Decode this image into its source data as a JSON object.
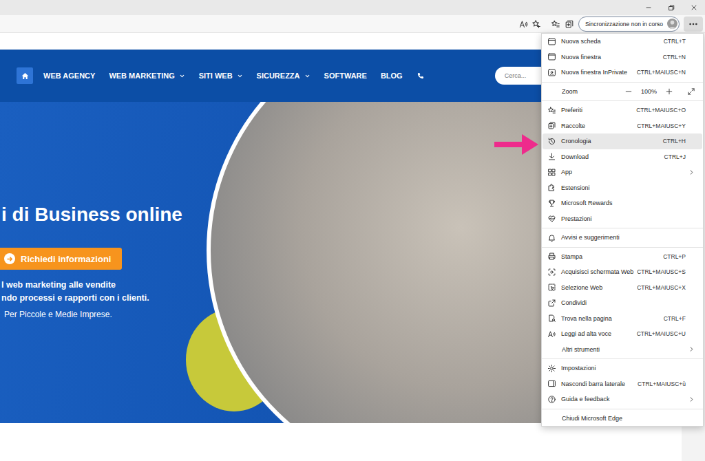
{
  "toolbar": {
    "sync_button": "Sincronizzazione non in corso"
  },
  "nav": {
    "items": [
      {
        "label": "WEB AGENCY",
        "dropdown": false
      },
      {
        "label": "WEB MARKETING",
        "dropdown": true
      },
      {
        "label": "SITI WEB",
        "dropdown": true
      },
      {
        "label": "SICUREZZA",
        "dropdown": true
      },
      {
        "label": "SOFTWARE",
        "dropdown": false
      },
      {
        "label": "BLOG",
        "dropdown": false
      }
    ],
    "search": {
      "placeholder": "Cerca..."
    }
  },
  "hero": {
    "headline": "i di Business online",
    "button": "Richiedi informazioni",
    "lines": [
      "l web marketing alle vendite",
      "ndo processi e rapporti con i clienti."
    ],
    "tagline": "Per Piccole e Medie Imprese."
  },
  "menu": {
    "sections": [
      [
        {
          "kind": "item",
          "label": "Nuova scheda",
          "shortcut": "CTRL+T",
          "submenu": false,
          "selected": false
        },
        {
          "kind": "item",
          "label": "Nuova finestra",
          "shortcut": "CTRL+N",
          "submenu": false,
          "selected": false
        },
        {
          "kind": "item",
          "label": "Nuova finestra InPrivate",
          "shortcut": "CTRL+MAIUSC+N",
          "submenu": false,
          "selected": false
        }
      ],
      [
        {
          "kind": "zoom",
          "label": "Zoom",
          "value": "100%",
          "submenu": false,
          "selected": false
        }
      ],
      [
        {
          "kind": "item",
          "label": "Preferiti",
          "shortcut": "CTRL+MAIUSC+O",
          "submenu": false,
          "selected": false
        },
        {
          "kind": "item",
          "label": "Raccolte",
          "shortcut": "CTRL+MAIUSC+Y",
          "submenu": false,
          "selected": false
        },
        {
          "kind": "item",
          "label": "Cronologia",
          "shortcut": "CTRL+H",
          "submenu": false,
          "selected": true
        },
        {
          "kind": "item",
          "label": "Download",
          "shortcut": "CTRL+J",
          "submenu": false,
          "selected": false
        },
        {
          "kind": "item",
          "label": "App",
          "submenu": true,
          "selected": false
        },
        {
          "kind": "item",
          "label": "Estensioni",
          "submenu": false,
          "selected": false
        },
        {
          "kind": "item",
          "label": "Microsoft Rewards",
          "submenu": false,
          "selected": false
        },
        {
          "kind": "item",
          "label": "Prestazioni",
          "submenu": false,
          "selected": false
        }
      ],
      [
        {
          "kind": "item",
          "label": "Avvisi e suggerimenti",
          "submenu": false,
          "selected": false
        }
      ],
      [
        {
          "kind": "item",
          "label": "Stampa",
          "shortcut": "CTRL+P",
          "submenu": false,
          "selected": false
        },
        {
          "kind": "item",
          "label": "Acquisisci schermata Web",
          "shortcut": "CTRL+MAIUSC+S",
          "submenu": false,
          "selected": false
        },
        {
          "kind": "item",
          "label": "Selezione Web",
          "shortcut": "CTRL+MAIUSC+X",
          "submenu": false,
          "selected": false
        },
        {
          "kind": "item",
          "label": "Condividi",
          "submenu": false,
          "selected": false
        },
        {
          "kind": "item",
          "label": "Trova nella pagina",
          "shortcut": "CTRL+F",
          "submenu": false,
          "selected": false
        },
        {
          "kind": "item",
          "label": "Leggi ad alta voce",
          "shortcut": "CTRL+MAIUSC+U",
          "submenu": false,
          "selected": false
        },
        {
          "kind": "item",
          "label": "Altri strumenti",
          "submenu": true,
          "selected": false
        }
      ],
      [
        {
          "kind": "item",
          "label": "Impostazioni",
          "submenu": false,
          "selected": false
        },
        {
          "kind": "item",
          "label": "Nascondi barra laterale",
          "shortcut": "CTRL+MAIUSC+ù",
          "submenu": false,
          "selected": false
        },
        {
          "kind": "item",
          "label": "Guida e feedback",
          "submenu": true,
          "selected": false
        }
      ],
      [
        {
          "kind": "item",
          "label": "Chiudi Microsoft Edge",
          "submenu": false,
          "selected": false
        }
      ]
    ]
  }
}
